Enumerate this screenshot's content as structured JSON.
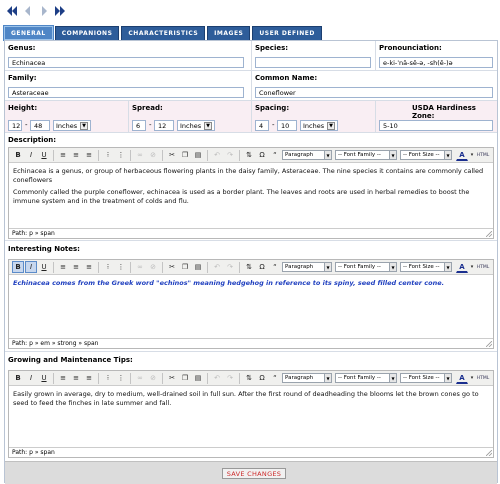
{
  "nav": {
    "buttons": [
      {
        "name": "first-icon"
      },
      {
        "name": "previous-icon"
      },
      {
        "name": "next-icon"
      },
      {
        "name": "last-icon"
      }
    ]
  },
  "tabs": [
    {
      "label": "GENERAL",
      "active": true
    },
    {
      "label": "COMPANIONS",
      "active": false
    },
    {
      "label": "CHARACTERISTICS",
      "active": false
    },
    {
      "label": "IMAGES",
      "active": false
    },
    {
      "label": "USER DEFINED",
      "active": false
    }
  ],
  "fields": {
    "genus": {
      "label": "Genus:",
      "value": "Echinacea"
    },
    "species": {
      "label": "Species:",
      "value": ""
    },
    "pronounciation": {
      "label": "Pronounciation:",
      "value": "e-ki-ˈnā-sē-ə, -sh(ē-)ə"
    },
    "family": {
      "label": "Family:",
      "value": "Asteraceae"
    },
    "common_name": {
      "label": "Common Name:",
      "value": "Coneflower"
    },
    "height": {
      "label": "Height:",
      "min": "12",
      "max": "48",
      "unit": "Inches"
    },
    "spread": {
      "label": "Spread:",
      "min": "6",
      "max": "12",
      "unit": "Inches"
    },
    "spacing": {
      "label": "Spacing:",
      "min": "4",
      "max": "10",
      "unit": "Inches"
    },
    "hardiness": {
      "label": "USDA Hardiness Zone:",
      "value": "5-10"
    }
  },
  "dash": "-",
  "editor_common": {
    "format_select": "Paragraph",
    "font_family_select": "-- Font Family --",
    "font_size_select": "-- Font Size --",
    "html_label": "HTML"
  },
  "description": {
    "title": "Description:",
    "paragraphs": [
      "Echinacea is a genus, or group of herbaceous flowering plants in the daisy family, Asteraceae. The nine species it contains are commonly called coneflowers",
      "Commonly called the purple coneflower, echinacea is used as a border plant. The leaves and roots are used in herbal remedies to boost the immune system and in the treatment of colds and flu."
    ],
    "path": "Path: p » span"
  },
  "notes": {
    "title": "Interesting Notes:",
    "text": "Echinacea comes from the Greek word \"echinos\" meaning hedgehog in reference to its spiny, seed filled center cone.",
    "path": "Path: p » em » strong » span"
  },
  "tips": {
    "title": "Growing and Maintenance Tips:",
    "text": "Easily grown in average, dry to medium, well-drained soil in full sun. After the first round of deadheading the blooms let the brown cones go to seed to feed the finches in late summer and fall.",
    "path": "Path: p » span"
  },
  "save_button": "SAVE CHANGES",
  "colors": {
    "tab_bg": "#2e5d9a",
    "tab_active": "#4f86c6",
    "notes_text": "#1f3fbf",
    "save_text": "#cc2a2a"
  }
}
